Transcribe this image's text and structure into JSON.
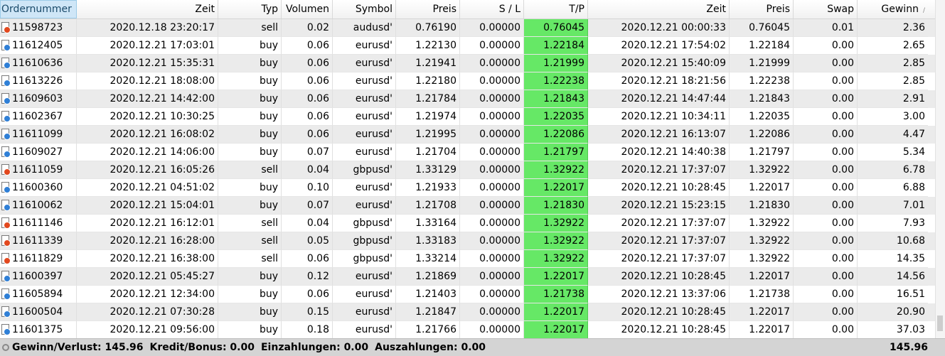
{
  "columns": {
    "order": "Ordernummer",
    "time_open": "Zeit",
    "type": "Typ",
    "volume": "Volumen",
    "symbol": "Symbol",
    "price_open": "Preis",
    "sl": "S / L",
    "tp": "T/P",
    "time_close": "Zeit",
    "price_close": "Preis",
    "swap": "Swap",
    "profit": "Gewinn"
  },
  "colors": {
    "tp_highlight": "#66e866",
    "sell_icon": "#e2481e",
    "buy_icon": "#2f7fd6"
  },
  "icons": {
    "sell": "order-sell-icon",
    "buy": "order-buy-icon"
  },
  "rows": [
    {
      "order": "11598723",
      "time_open": "2020.12.18 23:20:17",
      "type": "sell",
      "volume": "0.02",
      "symbol": "audusd'",
      "price_open": "0.76190",
      "sl": "0.00000",
      "tp": "0.76045",
      "time_close": "2020.12.21 00:00:33",
      "price_close": "0.76045",
      "swap": "0.01",
      "profit": "2.36"
    },
    {
      "order": "11612405",
      "time_open": "2020.12.21 17:03:01",
      "type": "buy",
      "volume": "0.06",
      "symbol": "eurusd'",
      "price_open": "1.22130",
      "sl": "0.00000",
      "tp": "1.22184",
      "time_close": "2020.12.21 17:54:02",
      "price_close": "1.22184",
      "swap": "0.00",
      "profit": "2.65"
    },
    {
      "order": "11610636",
      "time_open": "2020.12.21 15:35:31",
      "type": "buy",
      "volume": "0.06",
      "symbol": "eurusd'",
      "price_open": "1.21941",
      "sl": "0.00000",
      "tp": "1.21999",
      "time_close": "2020.12.21 15:40:09",
      "price_close": "1.21999",
      "swap": "0.00",
      "profit": "2.85"
    },
    {
      "order": "11613226",
      "time_open": "2020.12.21 18:08:00",
      "type": "buy",
      "volume": "0.06",
      "symbol": "eurusd'",
      "price_open": "1.22180",
      "sl": "0.00000",
      "tp": "1.22238",
      "time_close": "2020.12.21 18:21:56",
      "price_close": "1.22238",
      "swap": "0.00",
      "profit": "2.85"
    },
    {
      "order": "11609603",
      "time_open": "2020.12.21 14:42:00",
      "type": "buy",
      "volume": "0.06",
      "symbol": "eurusd'",
      "price_open": "1.21784",
      "sl": "0.00000",
      "tp": "1.21843",
      "time_close": "2020.12.21 14:47:44",
      "price_close": "1.21843",
      "swap": "0.00",
      "profit": "2.91"
    },
    {
      "order": "11602367",
      "time_open": "2020.12.21 10:30:25",
      "type": "buy",
      "volume": "0.06",
      "symbol": "eurusd'",
      "price_open": "1.21974",
      "sl": "0.00000",
      "tp": "1.22035",
      "time_close": "2020.12.21 10:34:11",
      "price_close": "1.22035",
      "swap": "0.00",
      "profit": "3.00"
    },
    {
      "order": "11611099",
      "time_open": "2020.12.21 16:08:02",
      "type": "buy",
      "volume": "0.06",
      "symbol": "eurusd'",
      "price_open": "1.21995",
      "sl": "0.00000",
      "tp": "1.22086",
      "time_close": "2020.12.21 16:13:07",
      "price_close": "1.22086",
      "swap": "0.00",
      "profit": "4.47"
    },
    {
      "order": "11609027",
      "time_open": "2020.12.21 14:06:00",
      "type": "buy",
      "volume": "0.07",
      "symbol": "eurusd'",
      "price_open": "1.21704",
      "sl": "0.00000",
      "tp": "1.21797",
      "time_close": "2020.12.21 14:40:38",
      "price_close": "1.21797",
      "swap": "0.00",
      "profit": "5.34"
    },
    {
      "order": "11611059",
      "time_open": "2020.12.21 16:05:26",
      "type": "sell",
      "volume": "0.04",
      "symbol": "gbpusd'",
      "price_open": "1.33129",
      "sl": "0.00000",
      "tp": "1.32922",
      "time_close": "2020.12.21 17:37:07",
      "price_close": "1.32922",
      "swap": "0.00",
      "profit": "6.78"
    },
    {
      "order": "11600360",
      "time_open": "2020.12.21 04:51:02",
      "type": "buy",
      "volume": "0.10",
      "symbol": "eurusd'",
      "price_open": "1.21933",
      "sl": "0.00000",
      "tp": "1.22017",
      "time_close": "2020.12.21 10:28:45",
      "price_close": "1.22017",
      "swap": "0.00",
      "profit": "6.88"
    },
    {
      "order": "11610062",
      "time_open": "2020.12.21 15:04:01",
      "type": "buy",
      "volume": "0.07",
      "symbol": "eurusd'",
      "price_open": "1.21708",
      "sl": "0.00000",
      "tp": "1.21830",
      "time_close": "2020.12.21 15:23:15",
      "price_close": "1.21830",
      "swap": "0.00",
      "profit": "7.01"
    },
    {
      "order": "11611146",
      "time_open": "2020.12.21 16:12:01",
      "type": "sell",
      "volume": "0.04",
      "symbol": "gbpusd'",
      "price_open": "1.33164",
      "sl": "0.00000",
      "tp": "1.32922",
      "time_close": "2020.12.21 17:37:07",
      "price_close": "1.32922",
      "swap": "0.00",
      "profit": "7.93"
    },
    {
      "order": "11611339",
      "time_open": "2020.12.21 16:28:00",
      "type": "sell",
      "volume": "0.05",
      "symbol": "gbpusd'",
      "price_open": "1.33183",
      "sl": "0.00000",
      "tp": "1.32922",
      "time_close": "2020.12.21 17:37:07",
      "price_close": "1.32922",
      "swap": "0.00",
      "profit": "10.68"
    },
    {
      "order": "11611829",
      "time_open": "2020.12.21 16:38:00",
      "type": "sell",
      "volume": "0.06",
      "symbol": "gbpusd'",
      "price_open": "1.33214",
      "sl": "0.00000",
      "tp": "1.32922",
      "time_close": "2020.12.21 17:37:07",
      "price_close": "1.32922",
      "swap": "0.00",
      "profit": "14.35"
    },
    {
      "order": "11600397",
      "time_open": "2020.12.21 05:45:27",
      "type": "buy",
      "volume": "0.12",
      "symbol": "eurusd'",
      "price_open": "1.21869",
      "sl": "0.00000",
      "tp": "1.22017",
      "time_close": "2020.12.21 10:28:45",
      "price_close": "1.22017",
      "swap": "0.00",
      "profit": "14.56"
    },
    {
      "order": "11605894",
      "time_open": "2020.12.21 12:34:00",
      "type": "buy",
      "volume": "0.06",
      "symbol": "eurusd'",
      "price_open": "1.21403",
      "sl": "0.00000",
      "tp": "1.21738",
      "time_close": "2020.12.21 13:37:06",
      "price_close": "1.21738",
      "swap": "0.00",
      "profit": "16.51"
    },
    {
      "order": "11600504",
      "time_open": "2020.12.21 07:30:28",
      "type": "buy",
      "volume": "0.15",
      "symbol": "eurusd'",
      "price_open": "1.21847",
      "sl": "0.00000",
      "tp": "1.22017",
      "time_close": "2020.12.21 10:28:45",
      "price_close": "1.22017",
      "swap": "0.00",
      "profit": "20.90"
    },
    {
      "order": "11601375",
      "time_open": "2020.12.21 09:56:00",
      "type": "buy",
      "volume": "0.18",
      "symbol": "eurusd'",
      "price_open": "1.21766",
      "sl": "0.00000",
      "tp": "1.22017",
      "time_close": "2020.12.21 10:28:45",
      "price_close": "1.22017",
      "swap": "0.00",
      "profit": "37.03"
    }
  ],
  "footer": {
    "profit_loss": "Gewinn/Verlust: 145.96",
    "credit": "Kredit/Bonus: 0.00",
    "deposits": "Einzahlungen: 0.00",
    "withdrawals": "Auszahlungen: 0.00",
    "total": "145.96"
  }
}
